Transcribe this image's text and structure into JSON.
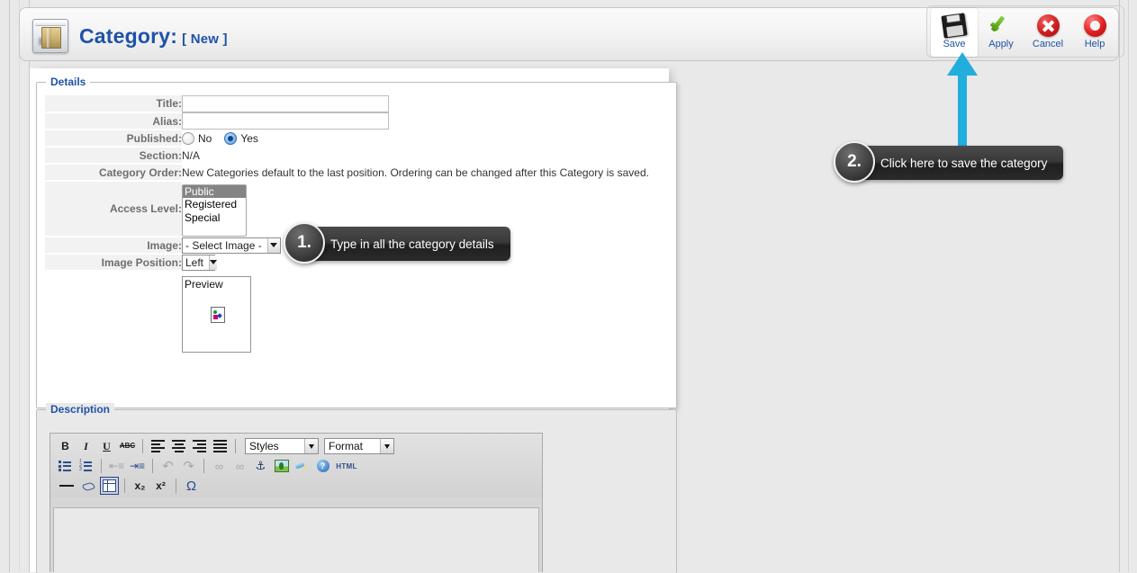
{
  "header": {
    "icon": "folder-window-icon",
    "title": "Category:",
    "subtitle": "[ New ]",
    "title_color": "#1f52a8"
  },
  "toolbar": {
    "buttons": [
      {
        "label": "Save",
        "icon": "floppy-disk-icon",
        "active": true
      },
      {
        "label": "Apply",
        "icon": "green-check-icon",
        "active": false
      },
      {
        "label": "Cancel",
        "icon": "red-x-circle-icon",
        "active": false
      },
      {
        "label": "Help",
        "icon": "lifebuoy-icon",
        "active": false
      }
    ]
  },
  "details": {
    "legend": "Details",
    "fields": {
      "title_label": "Title:",
      "title_value": "",
      "alias_label": "Alias:",
      "alias_value": "",
      "published_label": "Published:",
      "published_no": "No",
      "published_yes": "Yes",
      "published_selected": "Yes",
      "section_label": "Section:",
      "section_value": "N/A",
      "category_order_label": "Category Order:",
      "category_order_value": "New Categories default to the last position. Ordering can be changed after this Category is saved.",
      "access_level_label": "Access Level:",
      "access_level_options": [
        "Public",
        "Registered",
        "Special"
      ],
      "access_level_selected": "Public",
      "image_label": "Image:",
      "image_value": "- Select Image -",
      "image_position_label": "Image Position:",
      "image_position_value": "Left",
      "preview_label": "Preview",
      "preview_icon": "broken-image-icon"
    }
  },
  "description": {
    "legend": "Description",
    "editor": {
      "row1": [
        {
          "name": "bold",
          "glyph": "B"
        },
        {
          "name": "italic",
          "glyph": "I"
        },
        {
          "name": "underline",
          "glyph": "U"
        },
        {
          "name": "strikethrough",
          "glyph": "ABC"
        },
        {
          "name": "align-left",
          "glyph": ""
        },
        {
          "name": "align-center",
          "glyph": ""
        },
        {
          "name": "align-right",
          "glyph": ""
        },
        {
          "name": "align-justify",
          "glyph": ""
        }
      ],
      "styles_select": "Styles",
      "format_select": "Format",
      "row2": [
        {
          "name": "unordered-list",
          "glyph": ""
        },
        {
          "name": "ordered-list",
          "glyph": ""
        },
        {
          "name": "outdent",
          "glyph": ""
        },
        {
          "name": "indent",
          "glyph": ""
        },
        {
          "name": "undo",
          "glyph": "↶"
        },
        {
          "name": "redo",
          "glyph": "↷"
        },
        {
          "name": "link",
          "glyph": "∞"
        },
        {
          "name": "unlink",
          "glyph": "∞"
        },
        {
          "name": "anchor",
          "glyph": "⚓"
        },
        {
          "name": "insert-image",
          "glyph": ""
        },
        {
          "name": "cleanup",
          "glyph": ""
        },
        {
          "name": "help",
          "glyph": "?"
        },
        {
          "name": "html-source",
          "glyph": "HTML"
        }
      ],
      "row3": [
        {
          "name": "horizontal-rule",
          "glyph": ""
        },
        {
          "name": "remove-format",
          "glyph": ""
        },
        {
          "name": "insert-table",
          "glyph": ""
        },
        {
          "name": "subscript",
          "glyph": "x₂"
        },
        {
          "name": "superscript",
          "glyph": "x²"
        },
        {
          "name": "special-character",
          "glyph": "Ω"
        }
      ],
      "content": ""
    }
  },
  "callouts": [
    {
      "number": "1.",
      "text": "Type in all the category details"
    },
    {
      "number": "2.",
      "text": "Click here to save the category"
    }
  ],
  "annotation": {
    "arrow_color": "#22aedd",
    "arrow_target": "save-button"
  }
}
